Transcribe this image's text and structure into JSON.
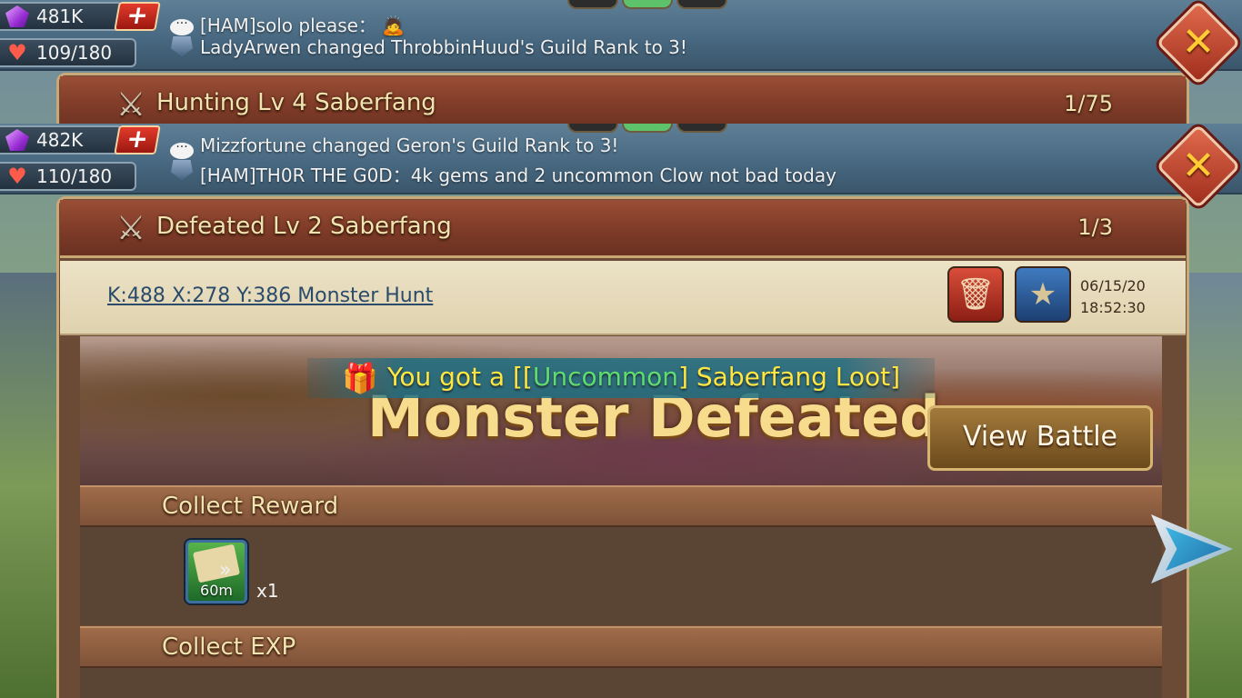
{
  "screens": [
    {
      "resources": {
        "gems": "481K",
        "hp": "109/180"
      },
      "chat": [
        {
          "text": "[HAM]solo please："
        },
        {
          "text": "LadyArwen changed ThrobbinHuud's Guild Rank to 3!"
        }
      ],
      "report": {
        "title": "Hunting Lv 4 Saberfang",
        "count": "1/75"
      }
    },
    {
      "resources": {
        "gems": "482K",
        "hp": "110/180"
      },
      "chat": [
        {
          "text": "Mizzfortune changed Geron's Guild Rank to 3!"
        },
        {
          "text": "[HAM]TH0R THE G0D：4k gems and 2 uncommon Clow not bad today"
        }
      ],
      "report": {
        "title": "Defeated Lv 2 Saberfang",
        "count": "1/3"
      }
    }
  ],
  "detail": {
    "location_link": "K:488 X:278 Y:386 Monster Hunt",
    "date": "06/15/20",
    "time": "18:52:30",
    "loot": {
      "prefix": "You got a [[",
      "rarity": "Uncommon",
      "suffix": "] Saberfang Loot]"
    },
    "banner_title": "Monster Defeated",
    "view_battle_label": "View Battle",
    "sections": {
      "reward_title": "Collect Reward",
      "exp_title": "Collect EXP"
    },
    "reward_item": {
      "icon": "speedup-book-icon",
      "duration": "60m",
      "quantity": "x1"
    }
  },
  "icons": {
    "gem": "gem-icon",
    "heart": "heart-icon",
    "plus": "plus-icon",
    "chat": "chat-bubble-icon",
    "guild": "guild-shield-icon",
    "close": "close-icon",
    "sword": "crossed-swords-icon",
    "delete": "trash-icon",
    "favorite": "star-icon",
    "gift": "gift-icon",
    "next": "next-arrow-icon"
  },
  "colors": {
    "close_accent": "#ffcc33",
    "loot_text": "#ffe640",
    "loot_rarity": "#5fdc6f",
    "link": "#2a4b6a"
  }
}
